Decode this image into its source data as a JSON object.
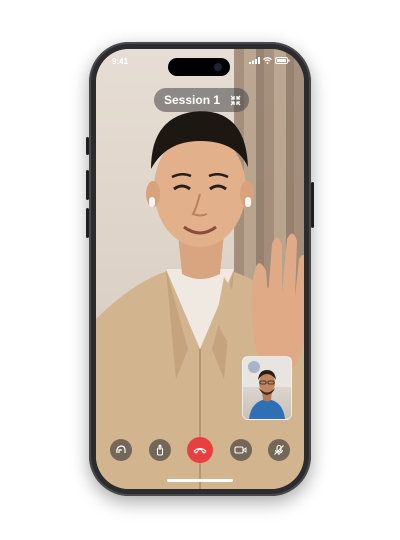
{
  "status_bar": {
    "time": "9:41"
  },
  "call": {
    "title": "Session 1",
    "minimize_icon": "minimize-arrows-icon"
  },
  "controls": [
    {
      "name": "flip-camera-button",
      "icon": "rotate-icon"
    },
    {
      "name": "share-button",
      "icon": "share-icon"
    },
    {
      "name": "end-call-button",
      "icon": "hangup-icon"
    },
    {
      "name": "video-toggle-button",
      "icon": "video-camera-icon"
    },
    {
      "name": "mute-button",
      "icon": "mic-off-icon"
    }
  ],
  "colors": {
    "end_call": "#e84040",
    "pip_shirt": "#2f6fb5"
  }
}
